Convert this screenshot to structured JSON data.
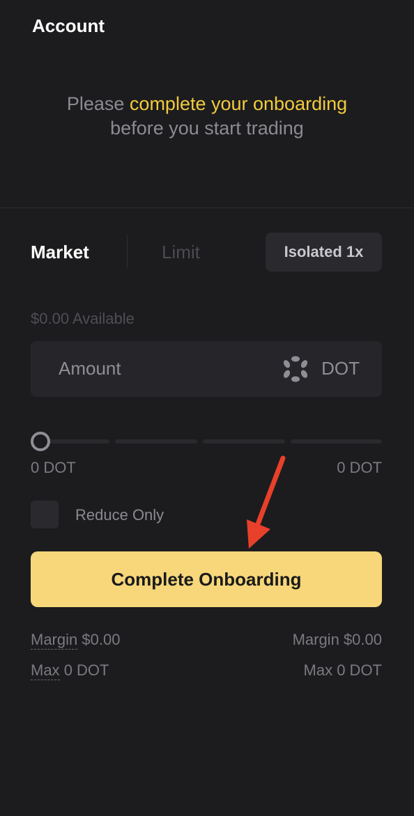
{
  "header": {
    "title": "Account"
  },
  "onboarding_message": {
    "prefix": "Please ",
    "highlight": "complete your onboarding",
    "suffix": "before you start trading"
  },
  "tabs": {
    "market": "Market",
    "limit": "Limit",
    "margin_mode": "Isolated 1x"
  },
  "available": "$0.00 Available",
  "amount": {
    "placeholder": "Amount",
    "currency": "DOT",
    "currency_icon": "polkadot-icon"
  },
  "slider": {
    "value": 0,
    "min_label": "0 DOT",
    "max_label": "0 DOT"
  },
  "reduce_only": {
    "label": "Reduce Only",
    "checked": false
  },
  "primary_button": {
    "label": "Complete Onboarding"
  },
  "stats": {
    "left": [
      {
        "label": "Margin",
        "value": "$0.00"
      },
      {
        "label": "Max",
        "value": "0 DOT"
      }
    ],
    "right": [
      {
        "label": "Margin",
        "value": "$0.00"
      },
      {
        "label": "Max",
        "value": "0 DOT"
      }
    ]
  },
  "colors": {
    "background": "#1c1c1e",
    "highlight": "#f2cb3d",
    "primary_button": "#f7d77a",
    "annotation_arrow": "#e8402a"
  }
}
